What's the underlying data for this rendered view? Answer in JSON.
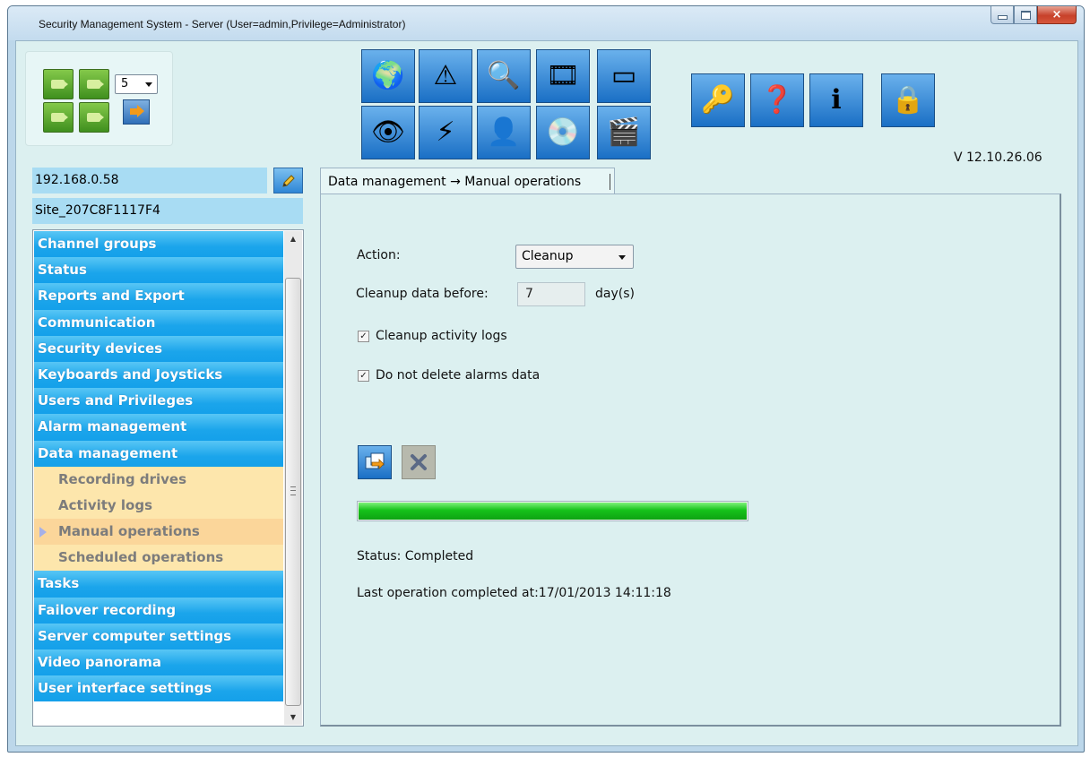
{
  "window": {
    "title": "Security Management System - Server (User=admin,Privilege=Administrator)",
    "buttons": {
      "minimize": "minimize-icon",
      "maximize": "maximize-icon",
      "close": "×"
    }
  },
  "camera_layout": {
    "cameras": [
      "camera-icon",
      "camera-icon",
      "camera-icon",
      "camera-icon"
    ],
    "count_select": "5",
    "apply_icon": "arrow-right-icon"
  },
  "toolbar": {
    "row1": [
      {
        "name": "globe-icon",
        "glyph": "🌍"
      },
      {
        "name": "warning-icon",
        "glyph": "⚠"
      },
      {
        "name": "search-icon",
        "glyph": "🔍"
      },
      {
        "name": "film-star-icon",
        "glyph": "🎞"
      },
      {
        "name": "windows-icon",
        "glyph": "▭"
      }
    ],
    "row2": [
      {
        "name": "eye-icon",
        "glyph": "👁"
      },
      {
        "name": "alarm-warning-icon",
        "glyph": "⚡"
      },
      {
        "name": "user-icon",
        "glyph": "👤"
      },
      {
        "name": "disc-icon",
        "glyph": "💿"
      },
      {
        "name": "film-export-icon",
        "glyph": "🎬"
      }
    ],
    "right": [
      {
        "name": "key-icon",
        "glyph": "🔑"
      },
      {
        "name": "help-document-icon",
        "glyph": "❓"
      },
      {
        "name": "info-icon",
        "glyph": "ℹ"
      },
      {
        "name": "lock-icon",
        "glyph": "🔒"
      }
    ]
  },
  "version": "V 12.10.26.06",
  "server": {
    "ip": "192.168.0.58",
    "site": "Site_207C8F1117F4",
    "edit_icon": "pencil-icon"
  },
  "nav": {
    "items": [
      {
        "label": "Channel groups",
        "type": "group"
      },
      {
        "label": "Status",
        "type": "group"
      },
      {
        "label": "Reports and Export",
        "type": "group"
      },
      {
        "label": "Communication",
        "type": "group"
      },
      {
        "label": "Security devices",
        "type": "group"
      },
      {
        "label": "Keyboards and Joysticks",
        "type": "group"
      },
      {
        "label": "Users and Privileges",
        "type": "group"
      },
      {
        "label": "Alarm management",
        "type": "group"
      },
      {
        "label": "Data management",
        "type": "group"
      },
      {
        "label": "Recording drives",
        "type": "sub"
      },
      {
        "label": "Activity logs",
        "type": "sub"
      },
      {
        "label": "Manual operations",
        "type": "sub",
        "active": true
      },
      {
        "label": "Scheduled operations",
        "type": "sub"
      },
      {
        "label": "Tasks",
        "type": "group"
      },
      {
        "label": "Failover recording",
        "type": "group"
      },
      {
        "label": "Server computer settings",
        "type": "group"
      },
      {
        "label": "Video panorama",
        "type": "group"
      },
      {
        "label": "User interface settings",
        "type": "group"
      }
    ]
  },
  "tab": {
    "label": "Data management → Manual operations"
  },
  "form": {
    "action_label": "Action:",
    "action_value": "Cleanup",
    "cleanup_before_label": "Cleanup data before:",
    "cleanup_before_value": "7",
    "cleanup_before_unit": "day(s)",
    "cleanup_activity_logs_label": "Cleanup activity logs",
    "cleanup_activity_logs_checked": true,
    "keep_alarms_label": "Do not delete alarms data",
    "keep_alarms_checked": true,
    "run_icon": "run-operation-icon",
    "cancel_icon": "cancel-icon",
    "progress": 1.0,
    "status": "Status: Completed",
    "last_operation": "Last operation completed at:17/01/2013 14:11:18"
  },
  "colors": {
    "client_bg": "#dcf0f0",
    "nav_group": "#1ba5eb",
    "nav_sub": "#fde6ac",
    "progress": "#16c21a",
    "toolbar_blue": "#1a6fc5"
  }
}
